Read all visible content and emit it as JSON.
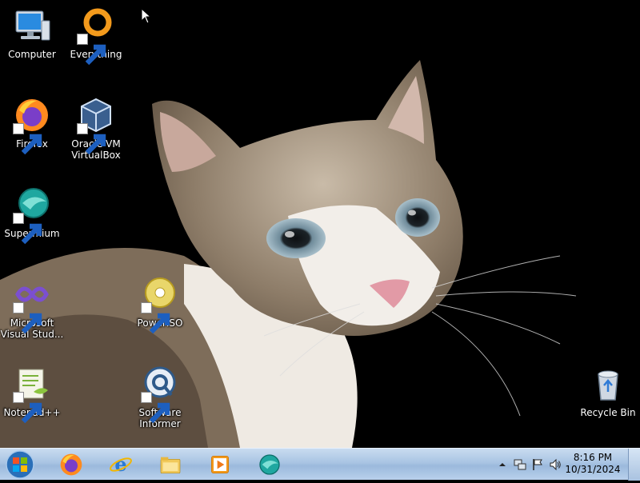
{
  "desktop": {
    "icons": [
      {
        "label": "Computer",
        "icon": "computer-icon"
      },
      {
        "label": "Everything",
        "icon": "everything-icon"
      },
      {
        "label": "Firefox",
        "icon": "firefox-icon"
      },
      {
        "label": "Oracle VM\nVirtualBox",
        "icon": "virtualbox-icon"
      },
      {
        "label": "Supermium",
        "icon": "supermium-icon"
      },
      {
        "label": "Microsoft\nVisual Stud...",
        "icon": "visual-studio-icon"
      },
      {
        "label": "PowerISO",
        "icon": "poweriso-icon"
      },
      {
        "label": "Notepad++",
        "icon": "notepadpp-icon"
      },
      {
        "label": "Software\nInformer",
        "icon": "software-informer-icon"
      },
      {
        "label": "Recycle Bin",
        "icon": "recycle-bin-icon"
      }
    ],
    "wallpaper": "cat-wallpaper"
  },
  "taskbar": {
    "pinned": [
      "firefox-icon",
      "internet-explorer-icon",
      "file-explorer-icon",
      "media-player-icon",
      "supermium-icon"
    ],
    "tray_icons": [
      "show-hidden-icons-arrow",
      "network-icon",
      "action-center-flag-icon",
      "volume-icon"
    ],
    "clock": {
      "time": "8:16 PM",
      "date": "10/31/2024"
    }
  },
  "colors": {
    "taskbar_top": "#c9dcf0",
    "taskbar_bottom": "#9bb9dc",
    "desktop_bg": "#000000"
  }
}
